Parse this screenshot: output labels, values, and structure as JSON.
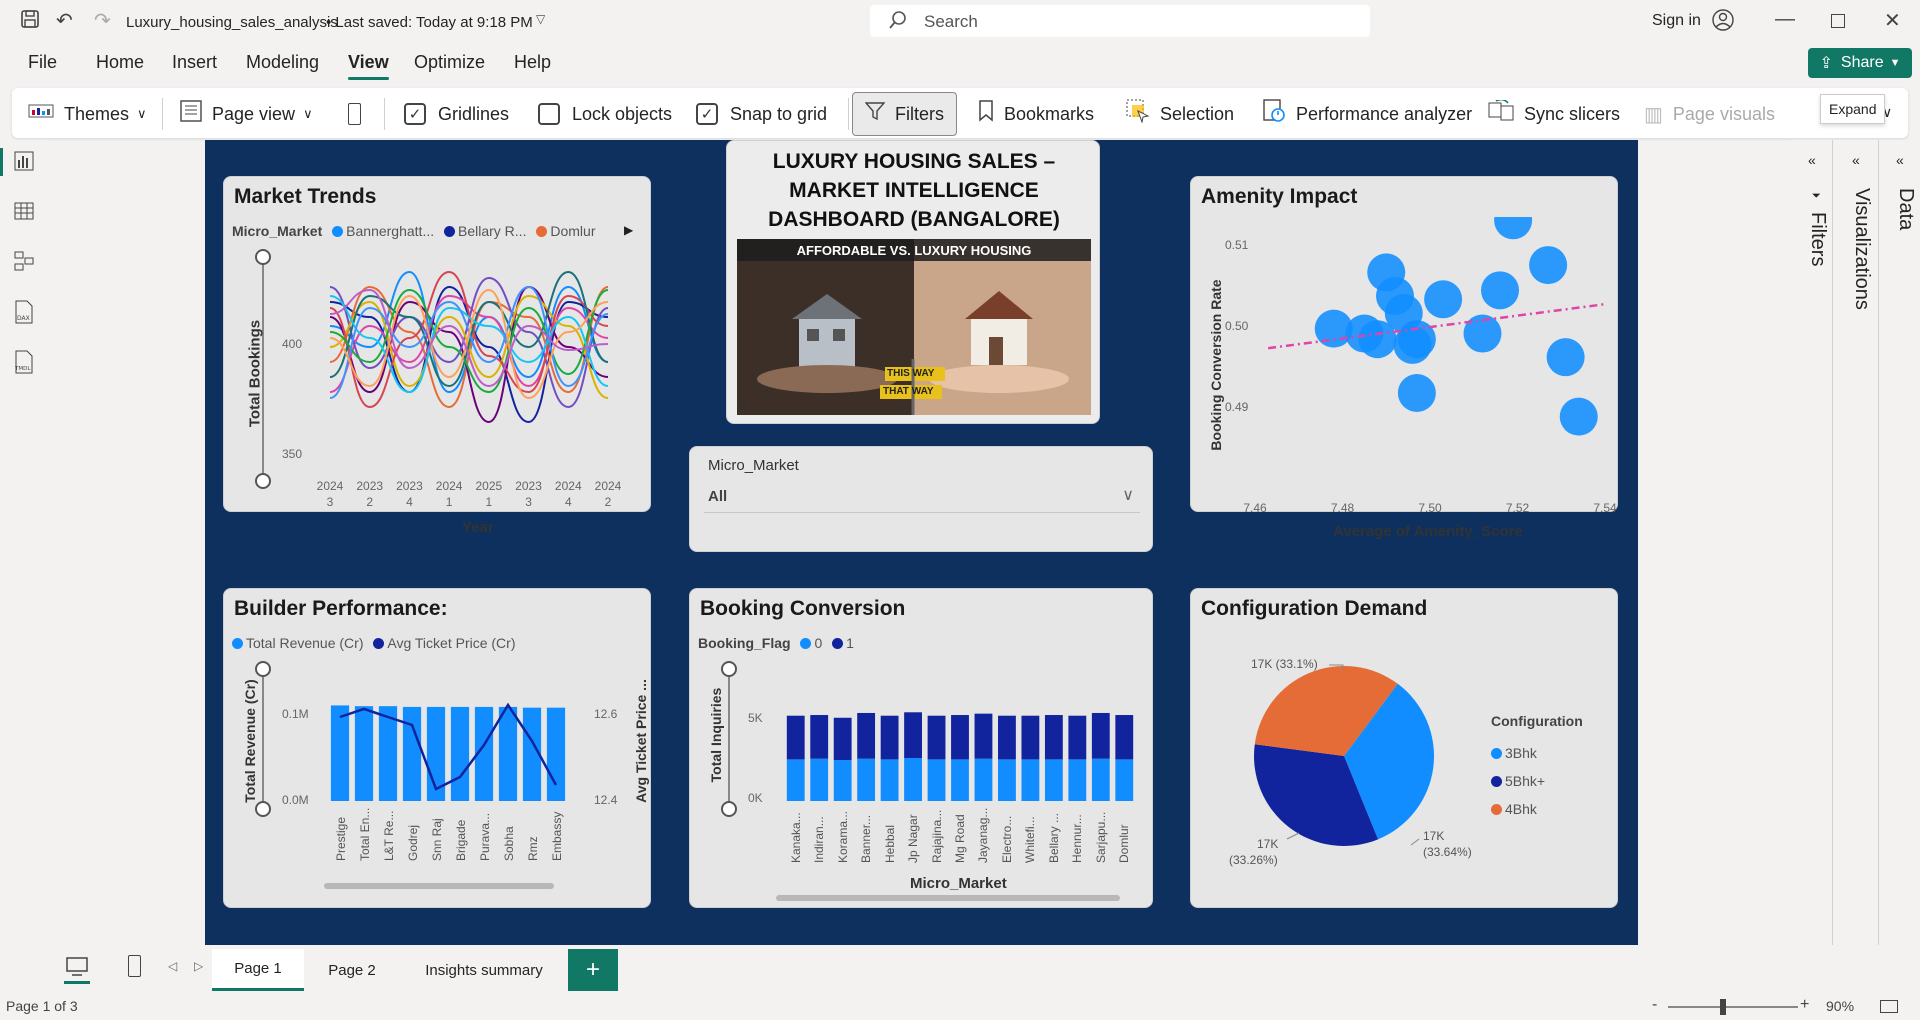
{
  "titlebar": {
    "filename": "Luxury_housing_sales_analysis",
    "saved": " • Last saved: Today at 9:18 PM",
    "search_placeholder": "Search",
    "sign_in": "Sign in"
  },
  "menu": [
    "File",
    "Home",
    "Insert",
    "Modeling",
    "View",
    "Optimize",
    "Help"
  ],
  "share_label": "Share",
  "ribbon": {
    "themes": "Themes",
    "page_view": "Page view",
    "gridlines": "Gridlines",
    "lock_objects": "Lock objects",
    "snap_to_grid": "Snap to grid",
    "filters": "Filters",
    "bookmarks": "Bookmarks",
    "selection": "Selection",
    "performance_analyzer": "Performance analyzer",
    "sync_slicers": "Sync slicers",
    "page_visuals": "Page visuals",
    "expand_tooltip": "Expand"
  },
  "dashboard": {
    "title": "LUXURY HOUSING SALES – MARKET INTELLIGENCE DASHBOARD (BANGALORE)",
    "banner_text": "AFFORDABLE VS. LUXURY HOUSING",
    "sign1": "THIS WAY",
    "sign2": "THAT WAY"
  },
  "slicer": {
    "label": "Micro_Market",
    "value": "All"
  },
  "panes": {
    "filters": "Filters",
    "visualizations": "Visualizations",
    "data": "Data"
  },
  "tabs": [
    "Page 1",
    "Page 2",
    "Insights summary"
  ],
  "status": {
    "page": "Page 1 of 3",
    "zoom": "90%"
  },
  "colors": {
    "accent": "#117865",
    "canvas": "#0d305f",
    "blue": "#118dff",
    "navy": "#12239e",
    "orange": "#e66c37",
    "pink": "#e044a7"
  },
  "chart_data": [
    {
      "type": "line",
      "title": "Market Trends",
      "legend_title": "Micro_Market",
      "legend": [
        "Bannerghatt...",
        "Bellary R...",
        "Domlur"
      ],
      "xlabel": "Year",
      "ylabel": "Total Bookings",
      "x_ticks": [
        [
          "2024",
          "3"
        ],
        [
          "2023",
          "2"
        ],
        [
          "2023",
          "4"
        ],
        [
          "2024",
          "1"
        ],
        [
          "2025",
          "1"
        ],
        [
          "2023",
          "3"
        ],
        [
          "2024",
          "4"
        ],
        [
          "2024",
          "2"
        ]
      ],
      "y_ticks": [
        "400",
        "350"
      ],
      "ylim": [
        345,
        415
      ],
      "series": [
        {
          "color": "#118dff",
          "values": [
            392,
            385,
            410,
            370,
            395,
            375,
            405,
            380
          ]
        },
        {
          "color": "#12239e",
          "values": [
            400,
            395,
            370,
            405,
            385,
            360,
            400,
            395
          ]
        },
        {
          "color": "#e66c37",
          "values": [
            380,
            405,
            390,
            365,
            400,
            395,
            370,
            405
          ]
        },
        {
          "color": "#6b007b",
          "values": [
            395,
            370,
            400,
            390,
            360,
            405,
            385,
            375
          ]
        },
        {
          "color": "#e044a7",
          "values": [
            370,
            392,
            380,
            402,
            395,
            372,
            398,
            388
          ]
        },
        {
          "color": "#744ec2",
          "values": [
            405,
            378,
            395,
            380,
            408,
            390,
            365,
            398
          ]
        },
        {
          "color": "#d9b300",
          "values": [
            385,
            400,
            372,
            395,
            375,
            402,
            392,
            368
          ]
        },
        {
          "color": "#d64550",
          "values": [
            398,
            365,
            388,
            410,
            382,
            370,
            402,
            392
          ]
        },
        {
          "color": "#197278",
          "values": [
            375,
            402,
            395,
            372,
            400,
            385,
            410,
            380
          ]
        },
        {
          "color": "#1aab40",
          "values": [
            390,
            380,
            404,
            385,
            370,
            398,
            376,
            404
          ]
        },
        {
          "color": "#15c6f4",
          "values": [
            402,
            388,
            370,
            398,
            392,
            380,
            395,
            372
          ]
        },
        {
          "color": "#4092ff",
          "values": [
            368,
            398,
            385,
            400,
            380,
            405,
            372,
            396
          ]
        },
        {
          "color": "#ffa058",
          "values": [
            388,
            372,
            402,
            375,
            404,
            368,
            390,
            400
          ]
        },
        {
          "color": "#be5dc9",
          "values": [
            396,
            404,
            378,
            392,
            372,
            392,
            384,
            386
          ]
        }
      ]
    },
    {
      "type": "scatter",
      "title": "Amenity Impact",
      "xlabel": "Average of Amenity_Score",
      "ylabel": "Booking Conversion Rate",
      "x_ticks": [
        "7.46",
        "7.48",
        "7.50",
        "7.52",
        "7.54"
      ],
      "y_ticks": [
        "0.51",
        "0.50",
        "0.49"
      ],
      "xlim": [
        7.46,
        7.54
      ],
      "ylim": [
        0.4865,
        0.5135
      ],
      "points": [
        {
          "x": 7.478,
          "y": 0.4998
        },
        {
          "x": 7.485,
          "y": 0.4992
        },
        {
          "x": 7.488,
          "y": 0.4985
        },
        {
          "x": 7.49,
          "y": 0.5067
        },
        {
          "x": 7.492,
          "y": 0.5038
        },
        {
          "x": 7.494,
          "y": 0.5017
        },
        {
          "x": 7.496,
          "y": 0.4978
        },
        {
          "x": 7.497,
          "y": 0.4985
        },
        {
          "x": 7.497,
          "y": 0.4919
        },
        {
          "x": 7.503,
          "y": 0.5034
        },
        {
          "x": 7.512,
          "y": 0.4992
        },
        {
          "x": 7.516,
          "y": 0.5045
        },
        {
          "x": 7.519,
          "y": 0.5131
        },
        {
          "x": 7.527,
          "y": 0.5076
        },
        {
          "x": 7.531,
          "y": 0.4963
        },
        {
          "x": 7.534,
          "y": 0.489
        }
      ],
      "trendline": {
        "x": [
          7.463,
          7.54
        ],
        "y": [
          0.4974,
          0.5028
        ]
      }
    },
    {
      "type": "bar",
      "title": "Builder Performance:",
      "legend": [
        "Total Revenue (Cr)",
        "Avg Ticket Price (Cr)"
      ],
      "ylabel": "Total Revenue (Cr)",
      "ylabel2": "Avg Ticket Price ...",
      "y_ticks": [
        "0.1M",
        "0.0M"
      ],
      "y2_ticks": [
        "12.6",
        "12.4"
      ],
      "categories": [
        "Prestige",
        "Total En...",
        "L&T Re...",
        "Godrej",
        "Snn Raj",
        "Brigade",
        "Purava...",
        "Sobha",
        "Rmz",
        "Embassy"
      ],
      "values": [
        0.128,
        0.127,
        0.127,
        0.126,
        0.126,
        0.126,
        0.126,
        0.126,
        0.125,
        0.125
      ],
      "ylim": [
        0,
        0.15
      ],
      "line_values": [
        12.59,
        12.61,
        12.59,
        12.57,
        12.41,
        12.44,
        12.52,
        12.62,
        12.53,
        12.42
      ],
      "y2lim": [
        12.38,
        12.66
      ]
    },
    {
      "type": "bar",
      "title": "Booking Conversion",
      "legend_title": "Booking_Flag",
      "legend": [
        "0",
        "1"
      ],
      "xlabel": "Micro_Market",
      "ylabel": "Total Inquiries",
      "y_ticks": [
        "5K",
        "0K"
      ],
      "ylim": [
        0,
        8500
      ],
      "categories": [
        "Kanaka...",
        "Indiran...",
        "Korama...",
        "Banner...",
        "Hebbal",
        "Jp Nagar",
        "Rajajina...",
        "Mg Road",
        "Jayanag...",
        "Electro...",
        "Whitefi...",
        "Bellary ...",
        "Hennur...",
        "Sarjapu...",
        "Domlur"
      ],
      "series": [
        {
          "name": "0",
          "values": [
            3050,
            3100,
            3000,
            3100,
            3050,
            3150,
            3050,
            3050,
            3100,
            3050,
            3050,
            3050,
            3050,
            3100,
            3050
          ]
        },
        {
          "name": "1",
          "values": [
            3200,
            3200,
            3100,
            3350,
            3200,
            3350,
            3200,
            3250,
            3300,
            3200,
            3200,
            3250,
            3200,
            3350,
            3250
          ]
        }
      ]
    },
    {
      "type": "pie",
      "title": "Configuration Demand",
      "legend_title": "Configuration",
      "slices": [
        {
          "label": "3Bhk",
          "value": 33.64,
          "text": "17K",
          "pct": "(33.64%)",
          "color": "#118dff"
        },
        {
          "label": "5Bhk+",
          "value": 33.26,
          "text": "17K",
          "pct": "(33.26%)",
          "color": "#12239e"
        },
        {
          "label": "4Bhk",
          "value": 33.1,
          "text": "17K (33.1%)",
          "pct": "",
          "color": "#e66c37"
        }
      ]
    }
  ]
}
